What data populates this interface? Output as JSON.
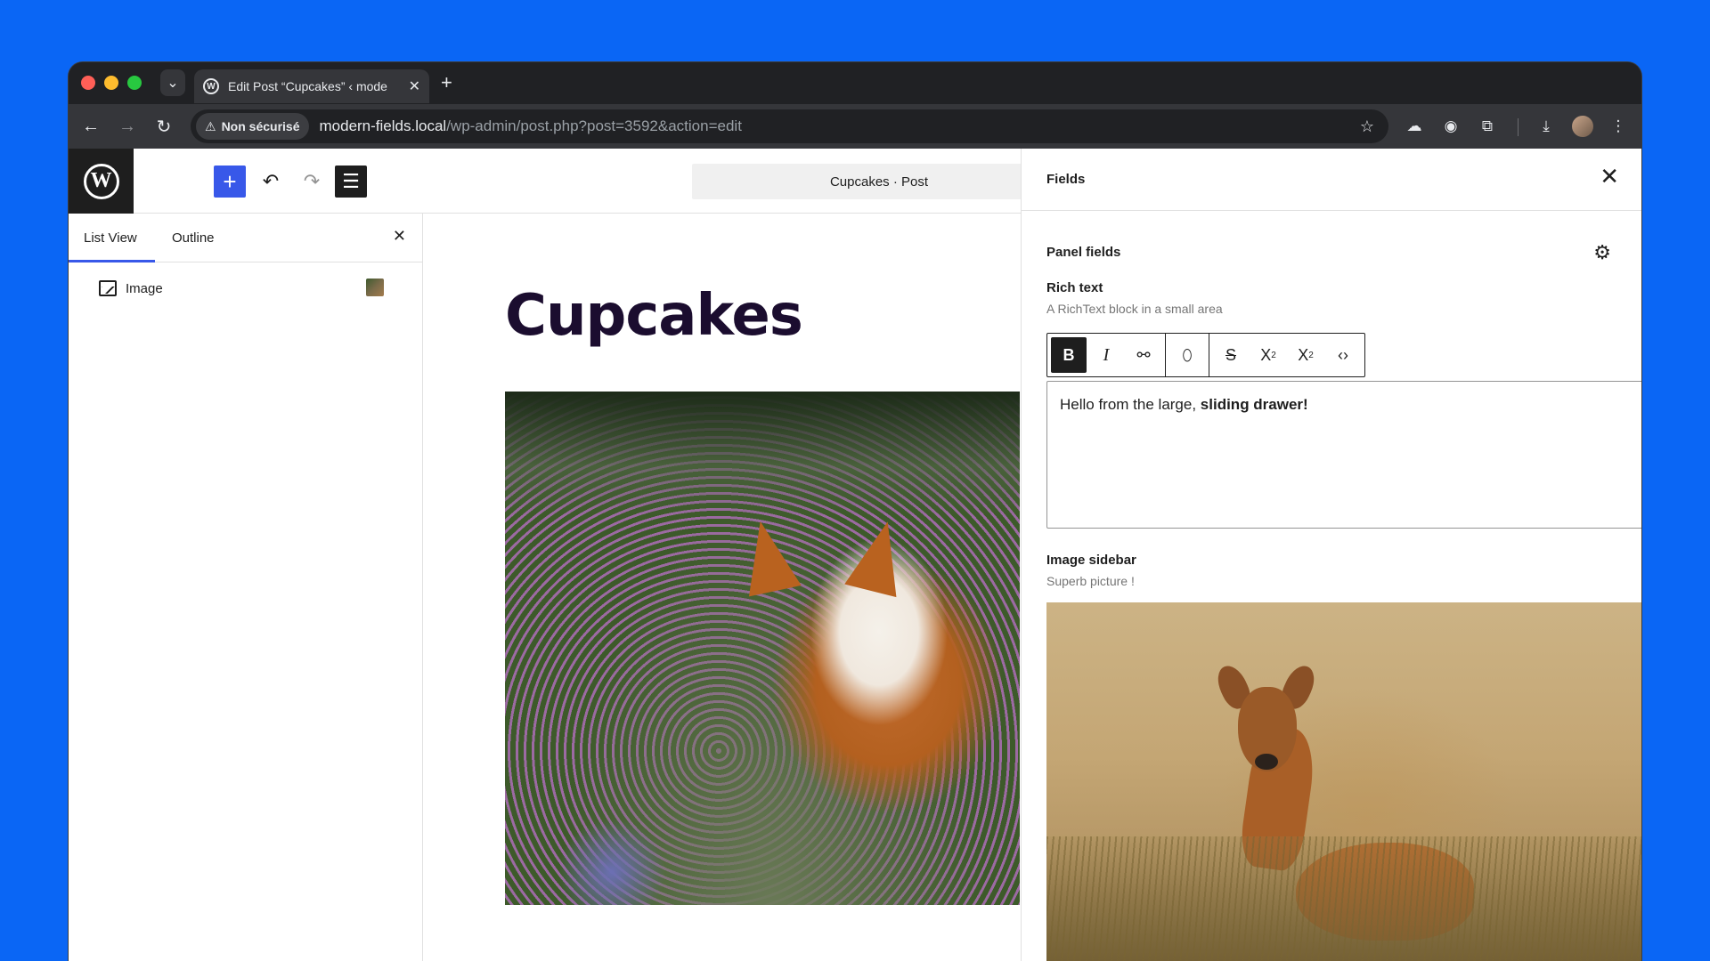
{
  "browser": {
    "tab_title": "Edit Post “Cupcakes” ‹ mode",
    "tab_close": "✕",
    "new_tab": "+",
    "security_label": "Non sécurisé",
    "url_host": "modern-fields.local",
    "url_path": "/wp-admin/post.php?post=3592&action=edit"
  },
  "editor": {
    "document_title": "Cupcakes · Post",
    "post_title": "Cupcakes"
  },
  "list_view": {
    "tabs": [
      {
        "label": "List View"
      },
      {
        "label": "Outline"
      }
    ],
    "items": [
      {
        "label": "Image"
      }
    ]
  },
  "fields_drawer": {
    "title": "Fields",
    "panel_title": "Panel fields",
    "rich_text": {
      "label": "Rich text",
      "help": "A RichText block in a small area",
      "content_plain": "Hello from the large, ",
      "content_bold": "sliding drawer!",
      "toolbar": {
        "bold": "B",
        "italic": "I",
        "strikethrough": "S",
        "superscript_base": "X",
        "superscript_mark": "2",
        "subscript_base": "X",
        "subscript_mark": "2"
      }
    },
    "image_sidebar": {
      "label": "Image sidebar",
      "help": "Superb picture !"
    }
  },
  "icons": {
    "back": "←",
    "forward": "→",
    "reload": "↻",
    "star": "☆",
    "close": "✕",
    "gear": "⚙",
    "undo": "↶",
    "redo": "↷",
    "plus": "+",
    "warning": "⚠",
    "chevron_down": "⌄",
    "more": "⋮",
    "download": "⤓",
    "link": "⚯",
    "drop": "⬯",
    "code": "‹›",
    "list": "☰",
    "cloud": "☁",
    "puzzle": "⧉"
  }
}
